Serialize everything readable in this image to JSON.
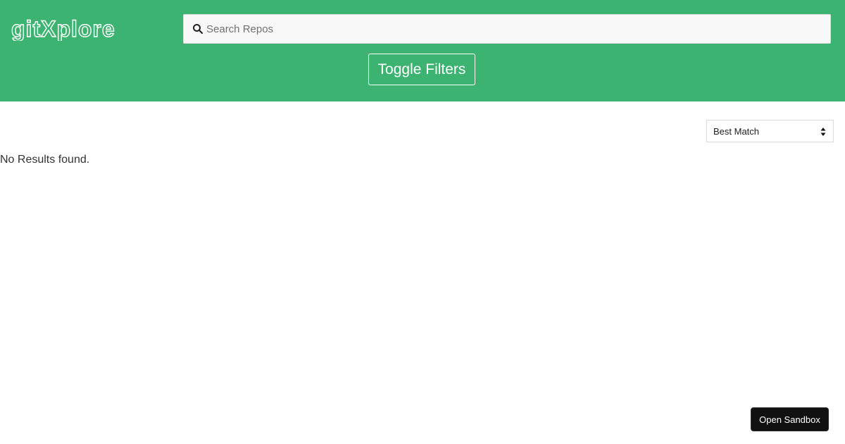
{
  "header": {
    "logo_text": "gitXplore",
    "background_color": "#3db371",
    "search": {
      "placeholder": "Search Repos",
      "value": "",
      "icon": "search-icon"
    },
    "toggle_filters_label": "Toggle Filters"
  },
  "main": {
    "sort": {
      "selected": "Best Match",
      "icon": "sort-arrows-icon"
    },
    "empty_message": "No Results found."
  },
  "footer": {
    "open_sandbox_label": "Open Sandbox"
  }
}
